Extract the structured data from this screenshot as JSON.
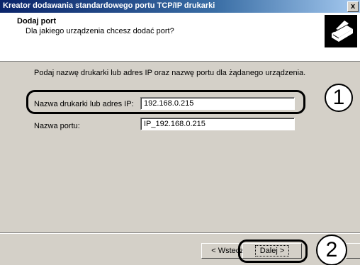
{
  "window": {
    "title": "Kreator dodawania standardowego portu TCP/IP drukarki",
    "close_label": "x"
  },
  "header": {
    "title": "Dodaj port",
    "subtitle": "Dla jakiego urządzenia chcesz dodać port?"
  },
  "instruction": "Podaj nazwę drukarki lub adres IP oraz nazwę portu dla żądanego urządzenia.",
  "fields": {
    "printer_name": {
      "label": "Nazwa drukarki lub adres IP:",
      "value": "192.168.0.215"
    },
    "port_name": {
      "label": "Nazwa portu:",
      "value": "IP_192.168.0.215"
    }
  },
  "callouts": {
    "first": "1",
    "second": "2"
  },
  "buttons": {
    "back": "< Wstecz",
    "next": "Dalej >"
  },
  "icons": {
    "printer": "printer-icon",
    "close": "close-icon"
  }
}
